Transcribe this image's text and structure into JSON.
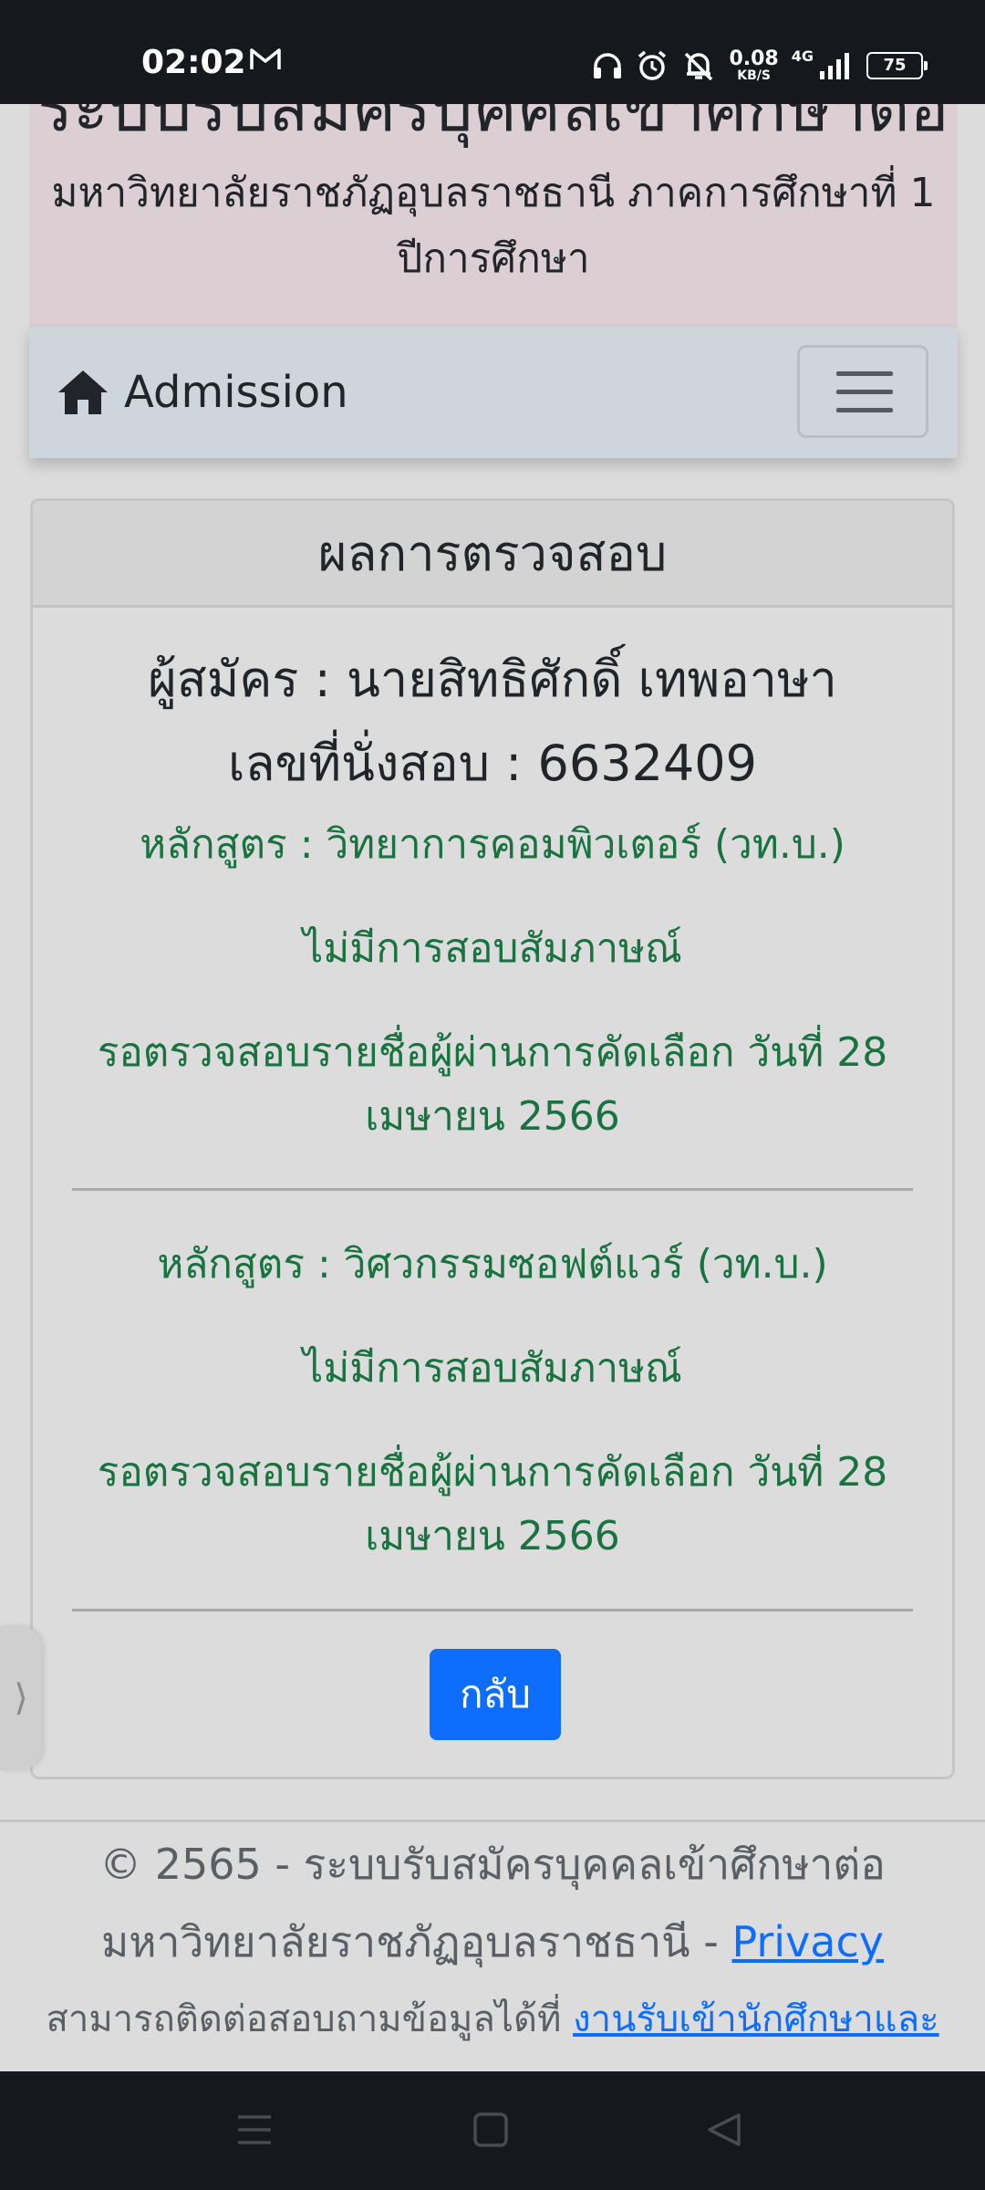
{
  "status_bar": {
    "time": "02:02",
    "net_speed_value": "0.08",
    "net_speed_unit": "KB/S",
    "network_type": "4G",
    "battery": "75"
  },
  "header": {
    "title_partial": "ระบบรับสมัครบุคคลเข้าศึกษาต่อ",
    "subtitle": "มหาวิทยาลัยราชภัฏอุบลราชธานี ภาคการศึกษาที่ 1 ปีการศึกษา"
  },
  "navbar": {
    "brand": "Admission",
    "brand_icon": "home-icon",
    "toggler_icon": "hamburger-icon"
  },
  "card": {
    "header": "ผลการตรวจสอบ",
    "applicant_line": "ผู้สมัคร : นายสิทธิศักดิ์ เทพอาษา",
    "seat_line": "เลขที่นั่งสอบ : 6632409",
    "programs": [
      {
        "course": "หลักสูตร : วิทยาการคอมพิวเตอร์ (วท.บ.)",
        "interview": "ไม่มีการสอบสัมภาษณ์",
        "status": "รอตรวจสอบรายชื่อผู้ผ่านการคัดเลือก วันที่ 28 เมษายน 2566"
      },
      {
        "course": "หลักสูตร : วิศวกรรมซอฟต์แวร์ (วท.บ.)",
        "interview": "ไม่มีการสอบสัมภาษณ์",
        "status": "รอตรวจสอบรายชื่อผู้ผ่านการคัดเลือก วันที่ 28 เมษายน 2566"
      }
    ],
    "back_button": "กลับ"
  },
  "footer": {
    "line1": "© 2565 - ระบบรับสมัครบุคคลเข้าศึกษาต่อ",
    "line2_text": "มหาวิทยาลัยราชภัฏอุบลราชธานี - ",
    "privacy_link": "Privacy",
    "line3_text": "สามารถติดต่อสอบถามข้อมูลได้ที่ ",
    "contact_link": "งานรับเข้านักศึกษาและ"
  },
  "colors": {
    "status_bar_bg": "#17181d",
    "header_bg": "#dbcfd4",
    "navbar_bg": "#cfd5dc",
    "status_text": "#18733f",
    "primary_button": "#0d6efd",
    "link": "#0d6efd"
  },
  "edge_handle_icon": "chevron-right-icon",
  "system_nav": {
    "menu_icon": "recent-apps-icon",
    "home_icon": "home-button-icon",
    "back_icon": "back-triangle-icon"
  }
}
